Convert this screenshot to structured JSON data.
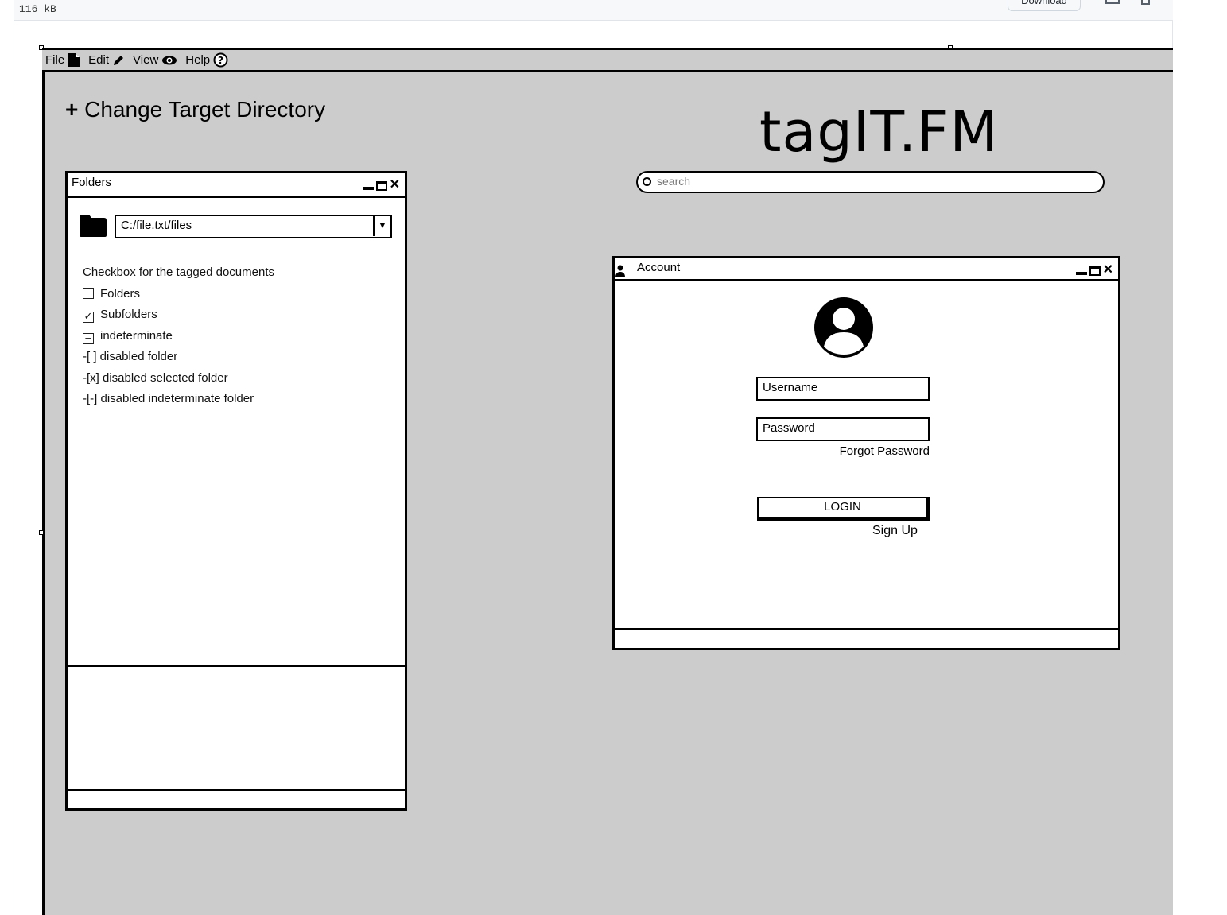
{
  "browser": {
    "file_size": "116 kB",
    "download_label": "Download"
  },
  "menu": {
    "items": [
      {
        "label": "File",
        "icon": "file-icon"
      },
      {
        "label": "Edit",
        "icon": "pencil-icon"
      },
      {
        "label": "View",
        "icon": "eye-icon"
      },
      {
        "label": "Help",
        "icon": "help-icon"
      }
    ]
  },
  "heading": {
    "plus": "+",
    "text": "Change Target Directory"
  },
  "logo": {
    "text": "tagIT.FM"
  },
  "search": {
    "placeholder": "search"
  },
  "folders_window": {
    "title": "Folders",
    "path": "C:/file.txt/files",
    "caption": "Checkbox for the tagged documents",
    "checkboxes": [
      {
        "label": "Folders",
        "state": "unchecked"
      },
      {
        "label": "Subfolders",
        "state": "checked"
      },
      {
        "label": "indeterminate",
        "state": "indeterminate"
      }
    ],
    "disabled_items": [
      "-[ ] disabled folder",
      "-[x] disabled selected folder",
      "-[-] disabled indeterminate folder"
    ]
  },
  "account_window": {
    "title": "Account",
    "username_placeholder": "Username",
    "password_placeholder": "Password",
    "forgot_password": "Forgot Password",
    "login": "LOGIN",
    "sign_up": "Sign Up"
  }
}
